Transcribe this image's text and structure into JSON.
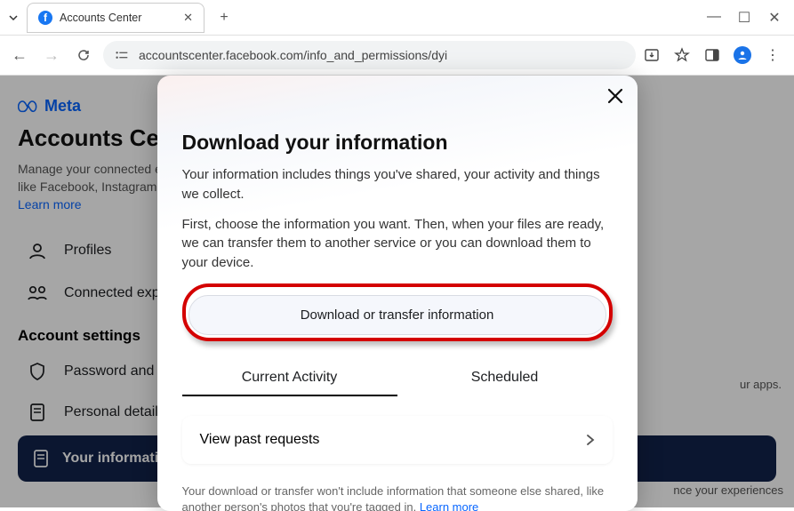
{
  "browser": {
    "tab_title": "Accounts Center",
    "url": "accountscenter.facebook.com/info_and_permissions/dyi"
  },
  "page": {
    "brand": "Meta",
    "title": "Accounts Center",
    "description": "Manage your connected experiences and account settings across Meta technologies like Facebook, Instagram and more.",
    "learn_more": "Learn more",
    "sidebar": {
      "profiles": "Profiles",
      "connected": "Connected experiences"
    },
    "settings_heading": "Account settings",
    "settings": {
      "password": "Password and security",
      "personal": "Personal details"
    },
    "info_card": "Your information and permissions",
    "ghost1": "ur apps.",
    "ghost2": "nce your experiences"
  },
  "modal": {
    "title": "Download your information",
    "p1": "Your information includes things you've shared, your activity and things we collect.",
    "p2": "First, choose the information you want. Then, when your files are ready, we can transfer them to another service or you can download them to your device.",
    "button": "Download or transfer information",
    "tabs": {
      "current": "Current Activity",
      "scheduled": "Scheduled"
    },
    "past_requests": "View past requests",
    "footnote_a": "Your download or transfer won't include information that someone else shared, like another person's photos that you're tagged in. ",
    "footnote_link": "Learn more"
  }
}
